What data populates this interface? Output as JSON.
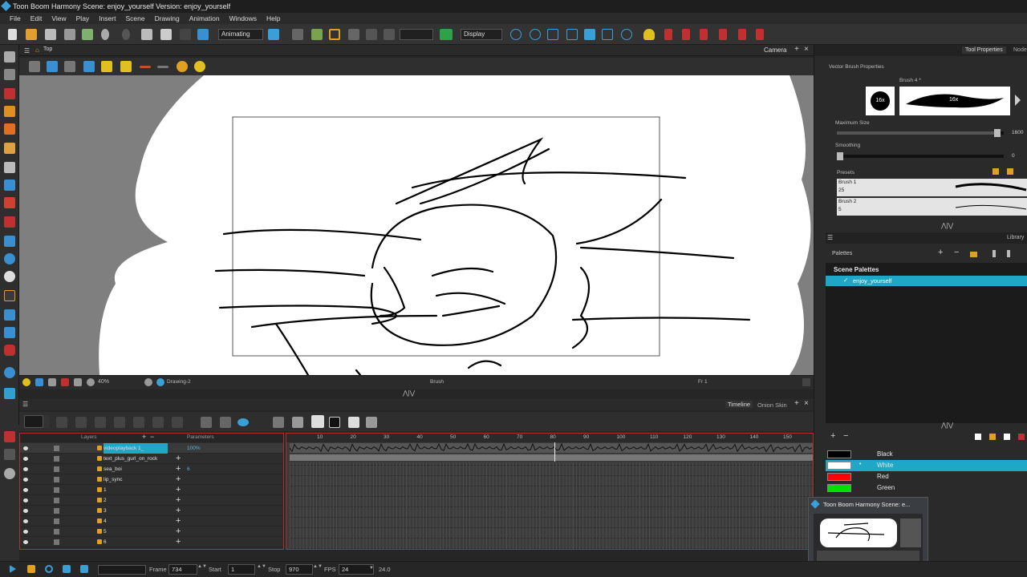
{
  "window": {
    "title": "Toon Boom Harmony Scene: enjoy_yourself Version: enjoy_yourself"
  },
  "menu": [
    "File",
    "Edit",
    "View",
    "Play",
    "Insert",
    "Scene",
    "Drawing",
    "Animation",
    "Windows",
    "Help"
  ],
  "toolbar": {
    "mode_select": "Animating",
    "display_select": "Display"
  },
  "camera_view": {
    "view_tab": "Top",
    "panel_title": "Camera",
    "zoom": "40%",
    "drawing_name": "Drawing-2",
    "tool_name": "Brush",
    "frame_label": "Fr 1"
  },
  "timeline": {
    "tab_timeline": "Timeline",
    "tab_onion": "Onion Skin",
    "col_layers": "Layers",
    "col_params": "Parameters",
    "ruler": [
      "10",
      "20",
      "30",
      "40",
      "50",
      "60",
      "70",
      "80",
      "90",
      "100",
      "110",
      "120",
      "130",
      "140",
      "150"
    ],
    "layers": [
      {
        "name": "videoplayback 1_",
        "value": "100%"
      },
      {
        "name": "text_plus_gurl_on_rock",
        "value": ""
      },
      {
        "name": "sea_boi",
        "value": "6"
      },
      {
        "name": "lip_sync",
        "value": ""
      },
      {
        "name": "1",
        "value": ""
      },
      {
        "name": "2",
        "value": ""
      },
      {
        "name": "3",
        "value": ""
      },
      {
        "name": "4",
        "value": ""
      },
      {
        "name": "5",
        "value": ""
      },
      {
        "name": "6",
        "value": ""
      }
    ]
  },
  "playback": {
    "frame_label": "Frame",
    "frame_value": "734",
    "start_label": "Start",
    "start_value": "1",
    "stop_label": "Stop",
    "stop_value": "970",
    "fps_label": "FPS",
    "fps_value": "24",
    "fps_readout": "24.0"
  },
  "tool_properties": {
    "tab": "Tool Properties",
    "tab2": "Node",
    "section": "Vector Brush Properties",
    "brush_name": "Brush 4 *",
    "brush_size_badge": "16x",
    "brush_preview_label": "16x",
    "max_size_label": "Maximum Size",
    "max_size_value": "1600",
    "max_size_fraction": 0.98,
    "smoothing_label": "Smoothing",
    "smoothing_value": "0",
    "smoothing_fraction": 0,
    "presets_label": "Presets",
    "presets": [
      {
        "name": "Brush 1",
        "size": "25"
      },
      {
        "name": "Brush 2",
        "size": "5"
      }
    ]
  },
  "palettes": {
    "label": "Palettes",
    "library_tab": "Library",
    "scene_palettes": "Scene Palettes",
    "selected_palette": "enjoy_yourself",
    "colors": [
      {
        "name": "Black",
        "hex": "#000000"
      },
      {
        "name": "White",
        "hex": "#ffffff",
        "selected": true
      },
      {
        "name": "Red",
        "hex": "#ff0000"
      },
      {
        "name": "Green",
        "hex": "#00e000"
      }
    ]
  },
  "taskbar_preview": {
    "title": "Toon Boom Harmony Scene: e..."
  },
  "colors": {
    "accent": "#1ea7c7",
    "selection": "#1ea7c7",
    "focus_border": "#b03030"
  }
}
